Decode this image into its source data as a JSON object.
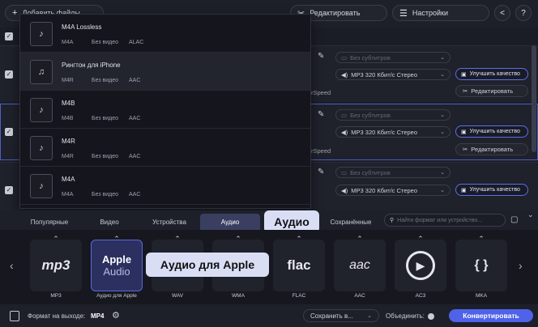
{
  "toolbar": {
    "add_files": "Добавить файлы",
    "edit": "Редактировать",
    "settings": "Настройки",
    "share_icon": "share-icon",
    "help": "?"
  },
  "dropdown": {
    "items": [
      {
        "name": "M4A Lossless",
        "ext": "M4A",
        "video": "Без видео",
        "codec": "ALAC"
      },
      {
        "name": "Рингтон для iPhone",
        "ext": "M4R",
        "video": "Без видео",
        "codec": "AAC"
      },
      {
        "name": "M4B",
        "ext": "M4B",
        "video": "Без видео",
        "codec": "AAC"
      },
      {
        "name": "M4R",
        "ext": "M4R",
        "video": "Без видео",
        "codec": "AAC"
      },
      {
        "name": "M4A",
        "ext": "M4A",
        "video": "Без видео",
        "codec": "AAC"
      }
    ]
  },
  "rows": [
    {
      "subtitles": "Без субтитров",
      "audio": "MP3 320 Кбит/с Стерео",
      "enhance": "Улучшить качество",
      "edit": "Редактировать",
      "speed": "rSpeed"
    },
    {
      "subtitles": "Без субтитров",
      "audio": "MP3 320 Кбит/с Стерео",
      "enhance": "Улучшить качество",
      "edit": "Редактировать",
      "speed": "rSpeed"
    },
    {
      "subtitles": "Без субтитров",
      "audio": "MP3 320 Кбит/с Стерео",
      "enhance": "Улучшить качество"
    }
  ],
  "tabs": [
    "Популярные",
    "Видео",
    "Устройства",
    "Аудио",
    "Сохранённые"
  ],
  "search_placeholder": "Найти формат или устройство...",
  "tooltip_tab": "Аудио",
  "tooltip_tile": "Аудио для Apple",
  "formats": [
    {
      "label": "MP3",
      "glyph": "mp3"
    },
    {
      "label": "Аудио для Apple",
      "glyph1": "Apple",
      "glyph2": "Audio"
    },
    {
      "label": "WAV",
      "glyph": "WAV"
    },
    {
      "label": "WMA",
      "glyph": "WMA"
    },
    {
      "label": "FLAC",
      "glyph": "flac"
    },
    {
      "label": "AAC",
      "glyph": "aac"
    },
    {
      "label": "AC3",
      "glyph": "▶"
    },
    {
      "label": "MKA",
      "glyph": "{ }"
    }
  ],
  "bottom": {
    "output_label": "Формат на выходе:",
    "output_value": "MP4",
    "save_to": "Сохранить в...",
    "merge": "Объединить:",
    "convert": "Конвертировать"
  }
}
